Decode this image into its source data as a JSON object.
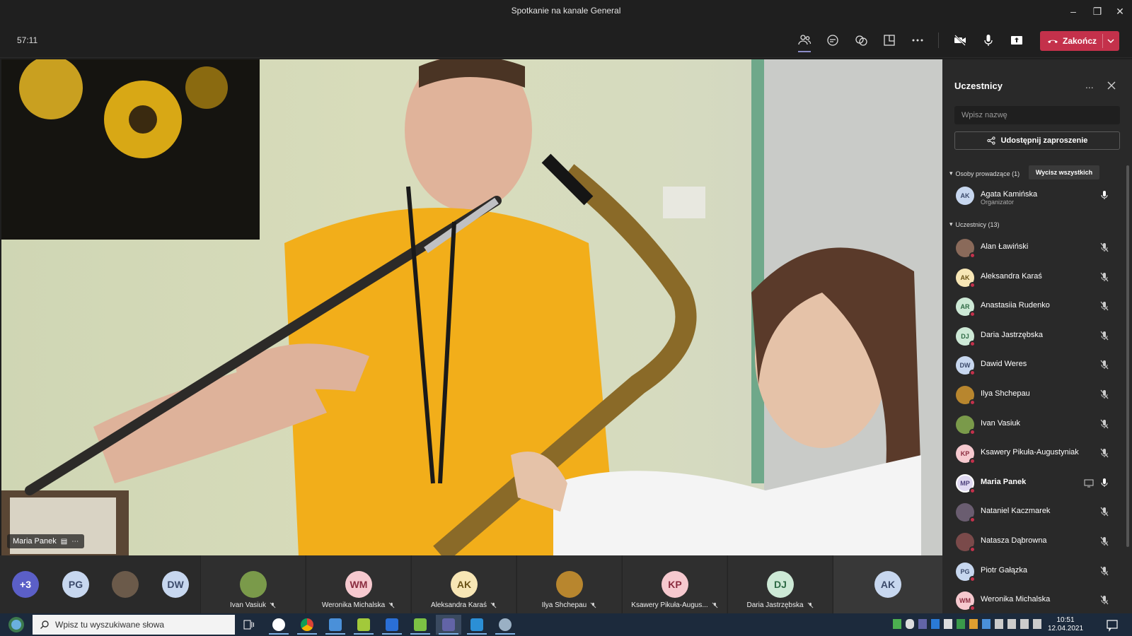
{
  "window": {
    "title": "Spotkanie na kanale General"
  },
  "toolbar": {
    "timer": "57:11",
    "end_call_label": "Zakończ",
    "end_call_color": "#c4314b"
  },
  "main_video": {
    "speaker_name": "Maria Panek"
  },
  "strip": {
    "overflow_label": "+3",
    "small_avatars": [
      {
        "initials": "PG",
        "bg": "#c7d7ef",
        "fg": "#3b4a6b"
      },
      {
        "initials": "",
        "bg": "#6b5a4a",
        "fg": "#fff",
        "photo": true
      },
      {
        "initials": "DW",
        "bg": "#c7d7ef",
        "fg": "#3b4a6b"
      }
    ],
    "tiles": [
      {
        "name": "Ivan Vasiuk",
        "initials": "",
        "bg": "#7a9a4a",
        "photo": true
      },
      {
        "name": "Weronika Michalska",
        "initials": "WM",
        "bg": "#f6c9cf",
        "fg": "#8a2c3f"
      },
      {
        "name": "Aleksandra Karaś",
        "initials": "AK",
        "bg": "#f7e6b5",
        "fg": "#6b5316"
      },
      {
        "name": "Ilya Shchepau",
        "initials": "",
        "bg": "#b8862e",
        "photo": true
      },
      {
        "name": "Ksawery Pikuła-Augus...",
        "initials": "KP",
        "bg": "#f6c9cf",
        "fg": "#8a2c3f"
      },
      {
        "name": "Daria Jastrzębska",
        "initials": "DJ",
        "bg": "#cde9d6",
        "fg": "#2e6a45"
      },
      {
        "name": "",
        "initials": "AK",
        "bg": "#c7d7ef",
        "fg": "#3b4a6b"
      }
    ]
  },
  "panel": {
    "title": "Uczestnicy",
    "more": "...",
    "search_placeholder": "Wpisz nazwę",
    "share_invite_label": "Udostępnij zaproszenie",
    "presenters_header": "Osoby prowadzące (1)",
    "mute_all_label": "Wycisz wszystkich",
    "attendees_header": "Uczestnicy (13)",
    "presenters": [
      {
        "name": "Agata Kamińska",
        "role": "Organizator",
        "initials": "AK",
        "bg": "#c7d7ef",
        "fg": "#3b4a6b",
        "muted": false
      }
    ],
    "attendees": [
      {
        "name": "Alan Ławiński",
        "initials": "",
        "bg": "#8a6a5a",
        "photo": true,
        "muted": true
      },
      {
        "name": "Aleksandra Karaś",
        "initials": "AK",
        "bg": "#f7e6b5",
        "fg": "#6b5316",
        "muted": true
      },
      {
        "name": "Anastasiia Rudenko",
        "initials": "AR",
        "bg": "#cde9d6",
        "fg": "#2e6a45",
        "muted": true
      },
      {
        "name": "Daria Jastrzębska",
        "initials": "DJ",
        "bg": "#cde9d6",
        "fg": "#2e6a45",
        "muted": true
      },
      {
        "name": "Dawid Weres",
        "initials": "DW",
        "bg": "#c7d7ef",
        "fg": "#3b4a6b",
        "muted": true
      },
      {
        "name": "Ilya Shchepau",
        "initials": "",
        "bg": "#b8862e",
        "photo": true,
        "muted": true
      },
      {
        "name": "Ivan Vasiuk",
        "initials": "",
        "bg": "#7a9a4a",
        "photo": true,
        "muted": true
      },
      {
        "name": "Ksawery Pikuła-Augustyniak",
        "initials": "KP",
        "bg": "#f6c9cf",
        "fg": "#8a2c3f",
        "muted": true
      },
      {
        "name": "Maria Panek",
        "initials": "MP",
        "bg": "#e0d9f2",
        "fg": "#4b3f7a",
        "muted": false,
        "sharing": true,
        "bold": true
      },
      {
        "name": "Nataniel Kaczmarek",
        "initials": "",
        "bg": "#6a5d70",
        "photo": true,
        "muted": true
      },
      {
        "name": "Natasza Dąbrowna",
        "initials": "",
        "bg": "#7a4a4a",
        "photo": true,
        "muted": true
      },
      {
        "name": "Piotr Gałązka",
        "initials": "PG",
        "bg": "#c7d7ef",
        "fg": "#3b4a6b",
        "muted": true
      },
      {
        "name": "Weronika Michalska",
        "initials": "WM",
        "bg": "#f6c9cf",
        "fg": "#8a2c3f",
        "muted": true
      }
    ]
  },
  "taskbar": {
    "search_placeholder": "Wpisz tu wyszukiwane słowa",
    "time": "10:51",
    "date": "12.04.2021"
  }
}
